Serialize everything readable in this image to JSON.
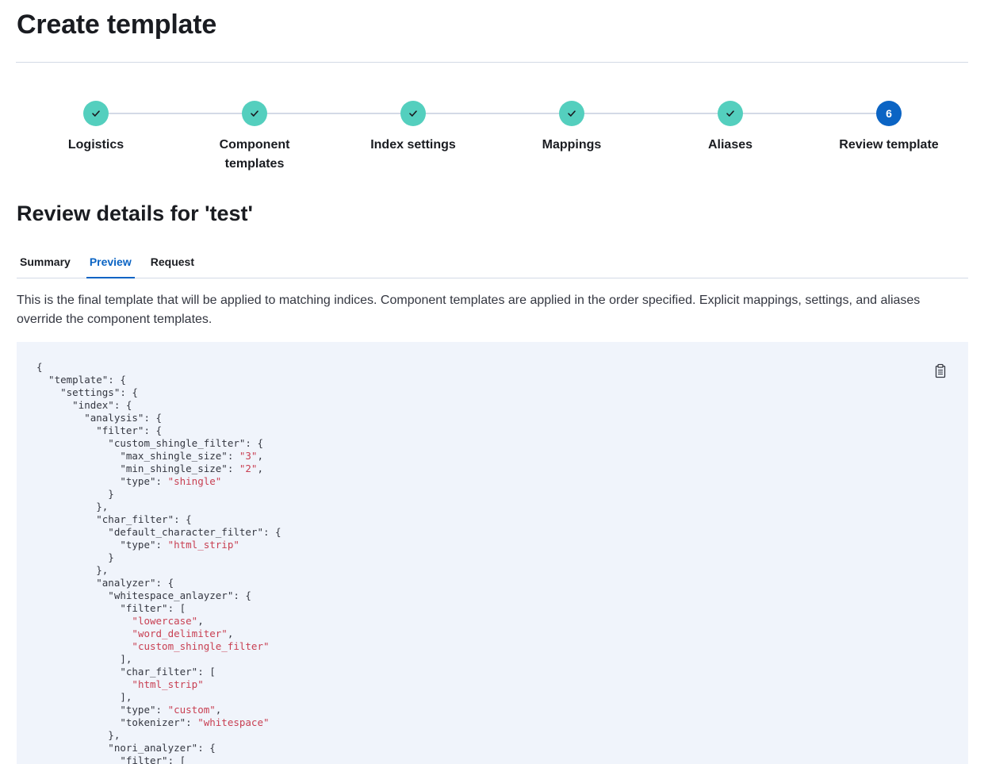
{
  "page": {
    "title": "Create template"
  },
  "steps": [
    {
      "label": "Logistics",
      "status": "complete",
      "icon": "check-icon"
    },
    {
      "label": "Component templates",
      "status": "complete",
      "icon": "check-icon"
    },
    {
      "label": "Index settings",
      "status": "complete",
      "icon": "check-icon"
    },
    {
      "label": "Mappings",
      "status": "complete",
      "icon": "check-icon"
    },
    {
      "label": "Aliases",
      "status": "complete",
      "icon": "check-icon"
    },
    {
      "label": "Review template",
      "status": "current",
      "number": "6"
    }
  ],
  "review": {
    "title": "Review details for 'test'",
    "tabs": [
      {
        "label": "Summary",
        "active": false
      },
      {
        "label": "Preview",
        "active": true
      },
      {
        "label": "Request",
        "active": false
      }
    ],
    "description": "This is the final template that will be applied to matching indices. Component templates are applied in the order specified. Explicit mappings, settings, and aliases override the component templates.",
    "copy_icon": "copy-clipboard-icon",
    "code": "{\n  \"template\": {\n    \"settings\": {\n      \"index\": {\n        \"analysis\": {\n          \"filter\": {\n            \"custom_shingle_filter\": {\n              \"max_shingle_size\": \"3\",\n              \"min_shingle_size\": \"2\",\n              \"type\": \"shingle\"\n            }\n          },\n          \"char_filter\": {\n            \"default_character_filter\": {\n              \"type\": \"html_strip\"\n            }\n          },\n          \"analyzer\": {\n            \"whitespace_anlayzer\": {\n              \"filter\": [\n                \"lowercase\",\n                \"word_delimiter\",\n                \"custom_shingle_filter\"\n              ],\n              \"char_filter\": [\n                \"html_strip\"\n              ],\n              \"type\": \"custom\",\n              \"tokenizer\": \"whitespace\"\n            },\n            \"nori_analyzer\": {\n              \"filter\": ["
  },
  "colors": {
    "step_complete": "#54cfbe",
    "step_current": "#0b64c4",
    "tab_active": "#0b64c4",
    "code_background": "#f0f4fb",
    "code_string": "#c83f52"
  }
}
